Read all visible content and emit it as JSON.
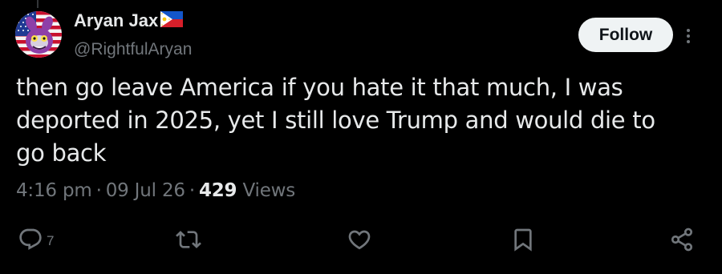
{
  "author": {
    "display_name": "Aryan Jax",
    "handle": "@RightfulAryan"
  },
  "follow_label": "Follow",
  "tweet": {
    "text": "then go leave America if you hate it that much, I was deported in 2025, yet I still love Trump and would die to go back",
    "time": "4:16 pm",
    "date": "09 Jul 26",
    "separator": "·",
    "views_count": "429",
    "views_label": "Views"
  },
  "actions": {
    "reply_count": "7"
  },
  "icons": {
    "avatar": "avatar-image",
    "flag": "philippines-flag-icon",
    "more": "more-options-icon",
    "reply": "reply-icon",
    "retweet": "retweet-icon",
    "like": "like-icon",
    "bookmark": "bookmark-icon",
    "share": "share-icon"
  },
  "colors": {
    "background": "#000000",
    "primary_text": "#e7e9ea",
    "secondary_text": "#71767b",
    "follow_bg": "#eff3f4",
    "follow_text": "#0f1419"
  }
}
